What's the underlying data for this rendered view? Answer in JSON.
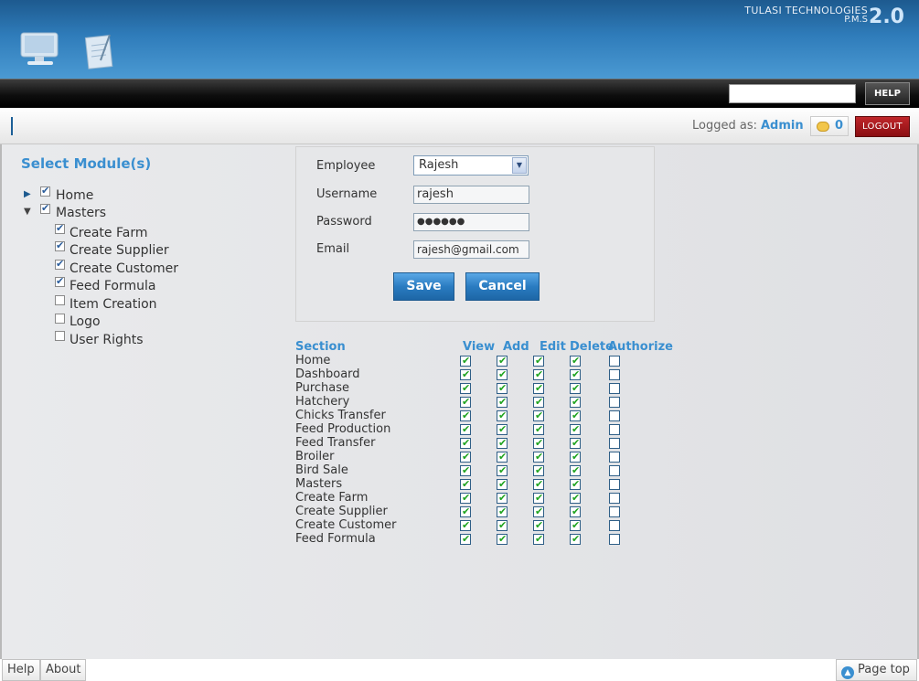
{
  "header": {
    "brand_name": "TULASI TECHNOLOGIES",
    "brand_sub": "P.M.S",
    "version": "2.0",
    "help_label": "HELP"
  },
  "status": {
    "logged_as_label": "Logged as:",
    "user": "Admin",
    "message_count": "0",
    "logout_label": "LOGOUT"
  },
  "modules": {
    "title": "Select Module(s)",
    "tree": [
      {
        "label": "Home",
        "checked": true,
        "toggle": "collapsed"
      },
      {
        "label": "Masters",
        "checked": true,
        "toggle": "expanded"
      },
      {
        "label": "Create Farm",
        "checked": true
      },
      {
        "label": "Create Supplier",
        "checked": true
      },
      {
        "label": "Create Customer",
        "checked": true
      },
      {
        "label": "Feed Formula",
        "checked": true
      },
      {
        "label": "Item Creation",
        "checked": false
      },
      {
        "label": "Logo",
        "checked": false
      },
      {
        "label": "User Rights",
        "checked": false
      }
    ]
  },
  "form": {
    "employee_label": "Employee",
    "employee_value": "Rajesh",
    "username_label": "Username",
    "username_value": "rajesh",
    "password_label": "Password",
    "password_value": "●●●●●●",
    "email_label": "Email",
    "email_value": "rajesh@gmail.com",
    "save_label": "Save",
    "cancel_label": "Cancel"
  },
  "permissions": {
    "headers": [
      "Section",
      "View",
      "Add",
      "Edit",
      "Delete",
      "Authorize"
    ],
    "rows": [
      {
        "section": "Home",
        "view": true,
        "add": true,
        "edit": true,
        "delete": true,
        "authorize": false
      },
      {
        "section": "Dashboard",
        "view": true,
        "add": true,
        "edit": true,
        "delete": true,
        "authorize": false
      },
      {
        "section": "Purchase",
        "view": true,
        "add": true,
        "edit": true,
        "delete": true,
        "authorize": false
      },
      {
        "section": "Hatchery",
        "view": true,
        "add": true,
        "edit": true,
        "delete": true,
        "authorize": false
      },
      {
        "section": "Chicks Transfer",
        "view": true,
        "add": true,
        "edit": true,
        "delete": true,
        "authorize": false
      },
      {
        "section": "Feed Production",
        "view": true,
        "add": true,
        "edit": true,
        "delete": true,
        "authorize": false
      },
      {
        "section": "Feed Transfer",
        "view": true,
        "add": true,
        "edit": true,
        "delete": true,
        "authorize": false
      },
      {
        "section": "Broiler",
        "view": true,
        "add": true,
        "edit": true,
        "delete": true,
        "authorize": false
      },
      {
        "section": "Bird Sale",
        "view": true,
        "add": true,
        "edit": true,
        "delete": true,
        "authorize": false
      },
      {
        "section": "Masters",
        "view": true,
        "add": true,
        "edit": true,
        "delete": true,
        "authorize": false
      },
      {
        "section": "Create Farm",
        "view": true,
        "add": true,
        "edit": true,
        "delete": true,
        "authorize": false
      },
      {
        "section": "Create Supplier",
        "view": true,
        "add": true,
        "edit": true,
        "delete": true,
        "authorize": false
      },
      {
        "section": "Create Customer",
        "view": true,
        "add": true,
        "edit": true,
        "delete": true,
        "authorize": false
      },
      {
        "section": "Feed Formula",
        "view": true,
        "add": true,
        "edit": true,
        "delete": true,
        "authorize": false
      }
    ]
  },
  "footer": {
    "help_label": "Help",
    "about_label": "About",
    "page_top_label": "Page top"
  },
  "colors": {
    "accent": "#3a8fd0",
    "logout": "#a01a1e",
    "check": "#1fa31f"
  }
}
